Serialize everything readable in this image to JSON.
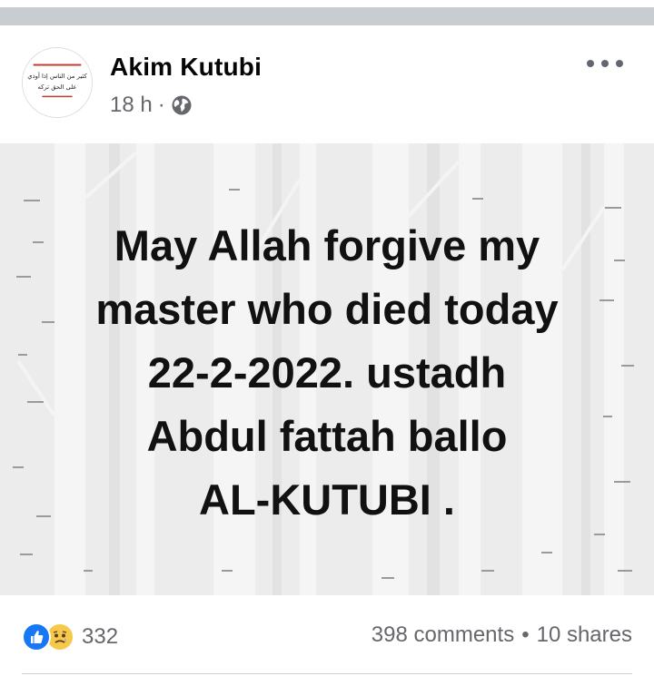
{
  "post": {
    "author": "Akim Kutubi",
    "time": "18 h",
    "separator": "·",
    "avatar_text": [
      "كثير من الناس إذا أوذي",
      "على الحق تركه"
    ],
    "body_lines": [
      "May Allah forgive my",
      "master who died today",
      "22-2-2022. ustadh",
      "Abdul fattah ballo",
      "AL-KUTUBI ."
    ]
  },
  "footer": {
    "reaction_count": "332",
    "comments": "398 comments",
    "bullet": "•",
    "shares": "10 shares"
  },
  "icons": {
    "privacy": "globe-icon",
    "menu": "more-options-icon",
    "reaction_1": "like-icon",
    "reaction_2": "sad-icon"
  },
  "colors": {
    "like_blue": "#1877f2",
    "sad_yellow": "#f7c94a",
    "secondary_text": "#65676b",
    "post_background": "#ececec"
  }
}
